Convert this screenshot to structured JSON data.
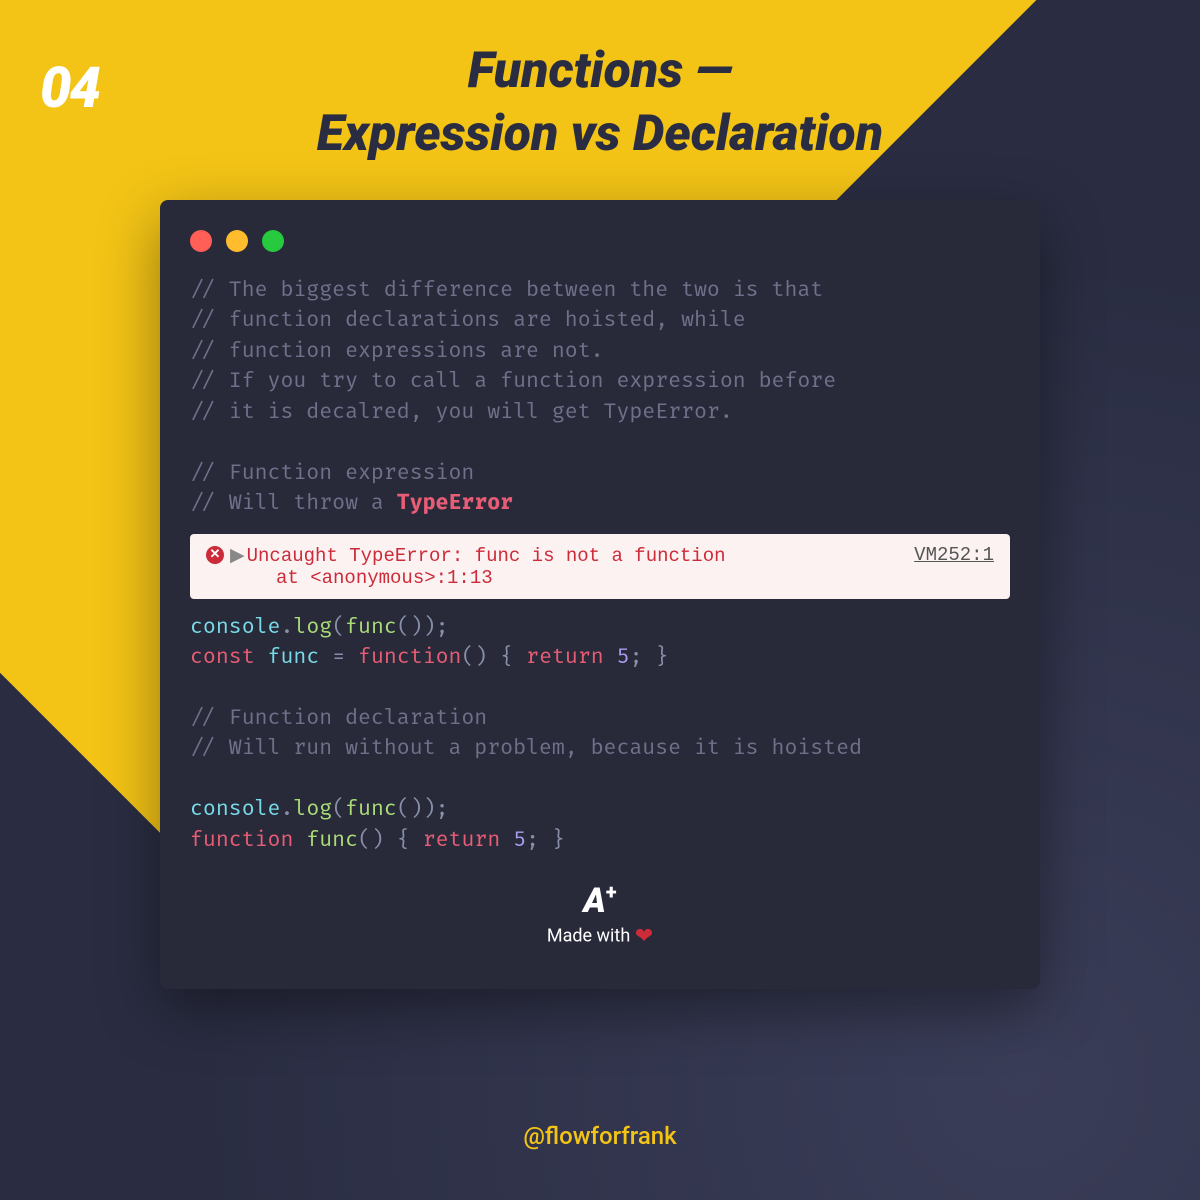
{
  "page_number": "04",
  "title_line1": "Functions —",
  "title_line2": "Expression vs Declaration",
  "comments_intro": [
    "// The biggest difference between the two is that",
    "// function declarations are hoisted, while",
    "// function expressions are not.",
    "// If you try to call a function expression before",
    "// it is decalred, you will get TypeError."
  ],
  "comments_expr": [
    "// Function expression",
    "// Will throw a "
  ],
  "typeerror_word": "TypeError",
  "error": {
    "line1": "Uncaught TypeError: func is not a function",
    "line2": "at <anonymous>:1:13",
    "ref": "VM252:1"
  },
  "expr_code": {
    "console": "console",
    "log": "log",
    "func": "func",
    "const": "const",
    "function": "function",
    "return": "return",
    "five": "5"
  },
  "comments_decl": [
    "// Function declaration",
    "// Will run without a problem, because it is hoisted"
  ],
  "badge": {
    "logo": "A",
    "plus": "+",
    "made_with": "Made with"
  },
  "handle": "@flowforfrank"
}
